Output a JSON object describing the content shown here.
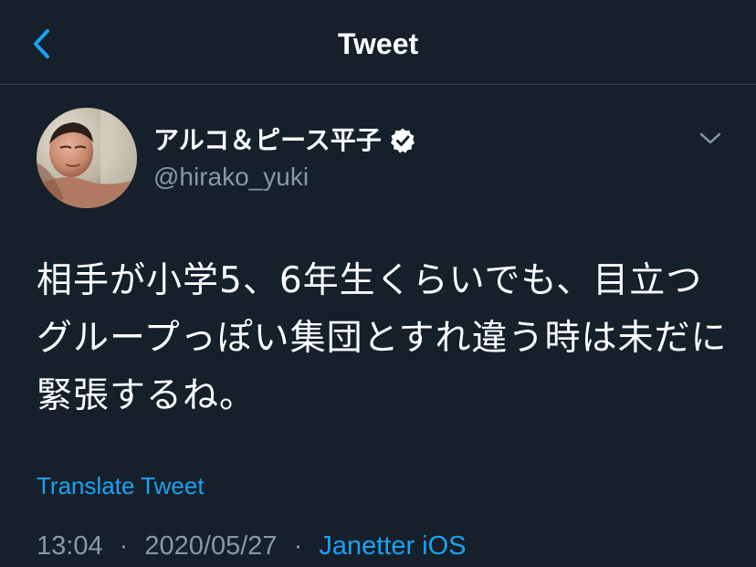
{
  "header": {
    "title": "Tweet",
    "back_icon": "chevron-left-icon"
  },
  "author": {
    "display_name": "アルコ＆ピース平子",
    "handle": "@hirako_yuki",
    "verified": true,
    "verified_icon": "verified-badge-icon",
    "menu_icon": "chevron-down-icon"
  },
  "tweet": {
    "text": "相手が小学5、6年生くらいでも、目立つグループっぽい集団とすれ違う時は未だに緊張するね。",
    "translate_label": "Translate Tweet",
    "time": "13:04",
    "separator": "·",
    "date": "2020/05/27",
    "source": "Janetter iOS"
  },
  "colors": {
    "background": "#15202b",
    "accent": "#1da1f2",
    "secondary_text": "#8899a6",
    "divider": "#38444d"
  }
}
